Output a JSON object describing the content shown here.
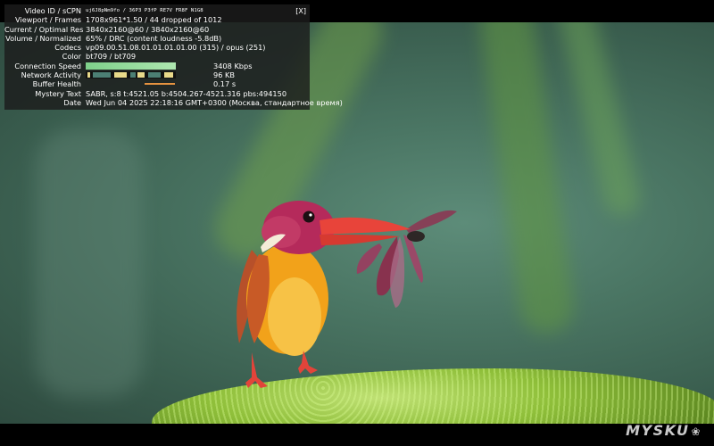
{
  "stats": {
    "close_label": "[X]",
    "rows": [
      {
        "label": "Video ID / sCPN",
        "value": "uj6J8pNm9fo / 36P3 P3fP RE7V FR8F N1G8"
      },
      {
        "label": "Viewport / Frames",
        "value": "1708x961*1.50 / 44 dropped of 1012"
      },
      {
        "label": "Current / Optimal Res",
        "value": "3840x2160@60 / 3840x2160@60"
      },
      {
        "label": "Volume / Normalized",
        "value": "65% / DRC (content loudness -5.8dB)"
      },
      {
        "label": "Codecs",
        "value": "vp09.00.51.08.01.01.01.01.00 (315) / opus (251)"
      },
      {
        "label": "Color",
        "value": "bt709 / bt709"
      },
      {
        "label": "Connection Speed",
        "value": "3408 Kbps"
      },
      {
        "label": "Network Activity",
        "value": "96 KB"
      },
      {
        "label": "Buffer Health",
        "value": "0.17 s"
      },
      {
        "label": "Mystery Text",
        "value": "SABR, s:8 t:4521.05 b:4504.267-4521.316 pbs:494150"
      },
      {
        "label": "Date",
        "value": "Wed Jun 04 2025 22:18:16 GMT+0300 (Москва, стандартное время)"
      }
    ],
    "colors": {
      "speed_bar": "#8fdca0",
      "network_bar_accent": "#e8d98a",
      "buffer_bar": "#e69340"
    }
  },
  "watermark": {
    "text": "MYSKU",
    "icon": "paw-icon"
  }
}
